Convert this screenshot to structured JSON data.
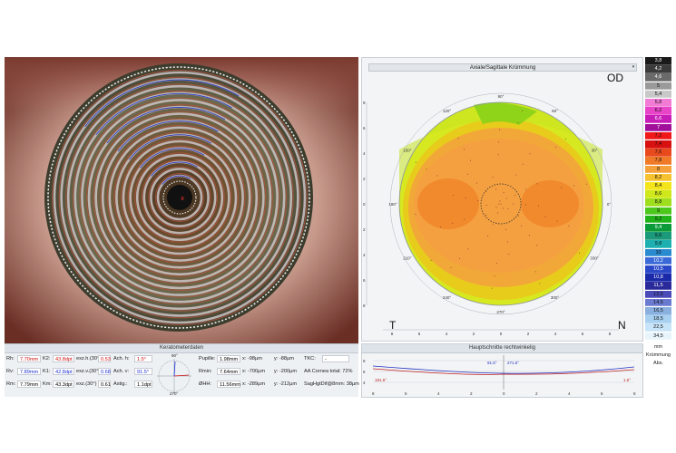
{
  "map": {
    "title": "Axiale/Sagittale Krümmung",
    "dropdown_glyph": "▾",
    "eye_side": "OD",
    "temporal_label": "T",
    "nasal_label": "N",
    "angle_labels": [
      "90°",
      "60°",
      "30°",
      "0°",
      "330°",
      "300°",
      "270°",
      "240°",
      "210°",
      "180°",
      "150°",
      "120°"
    ],
    "axis_ticks_h": [
      "8",
      "6",
      "4",
      "2",
      "0",
      "2",
      "4",
      "6",
      "8"
    ],
    "axis_ticks_v": [
      "8",
      "6",
      "4",
      "2",
      "0",
      "2",
      "4",
      "6",
      "8"
    ]
  },
  "scale": {
    "values": [
      "3,8",
      "4,2",
      "4,6",
      "5",
      "5,4",
      "5,8",
      "6,2",
      "6,6",
      "7",
      "7,2",
      "7,4",
      "7,6",
      "7,8",
      "8",
      "8,2",
      "8,4",
      "8,6",
      "8,8",
      "9",
      "9,2",
      "9,4",
      "9,6",
      "9,8",
      "10",
      "10,2",
      "10,5",
      "10,8",
      "11,5",
      "12,5",
      "14,5",
      "16,5",
      "18,5",
      "22,5",
      "34,5"
    ],
    "colors": [
      "#1a1a1a",
      "#3b3b3b",
      "#6a6a6a",
      "#9a9a9a",
      "#c8c8c8",
      "#f27bd6",
      "#e844c8",
      "#c81eb8",
      "#a0109a",
      "#f01818",
      "#d81010",
      "#e84a1e",
      "#f07a28",
      "#f5a03a",
      "#f7c230",
      "#f3e41c",
      "#cfe81c",
      "#9fde1c",
      "#4cc81c",
      "#20b41a",
      "#0a9a3a",
      "#1a9a7a",
      "#1eb0b0",
      "#2a8ad0",
      "#3a6ad8",
      "#2a48c8",
      "#1a2aa8",
      "#2a2a9a",
      "#4a4ab8",
      "#6a7ad0",
      "#8ab0e0",
      "#a8d0f0",
      "#c8e4f8",
      "#e8f4fc"
    ],
    "unit1": "mm",
    "unit2": "Krümmung",
    "unit3": "Abs."
  },
  "kerato": {
    "title": "Keratometerdaten",
    "rows": [
      {
        "r_label": "Rh:",
        "r_val": "7.70mm",
        "k_label": "K2:",
        "k_val": "43.8dpt",
        "exz_label": "exz.h.(30°)",
        "exz_val": "0.53",
        "ach_label": "Ach. h:",
        "ach_val": "1.5°"
      },
      {
        "r_label": "Rv:",
        "r_val": "7.89mm",
        "k_label": "K1:",
        "k_val": "42.8dpt",
        "exz_label": "exz.v.(30°)",
        "exz_val": "0.68",
        "ach_label": "Ach. v:",
        "ach_val": "91.5°"
      },
      {
        "r_label": "Rm:",
        "r_val": "7.79mm",
        "k_label": "Km:",
        "k_val": "43.3dpt",
        "exz_label": "exz.(30°)",
        "exz_val": "0.61",
        "ach_label": "Astig.:",
        "ach_val": "1.1dpt"
      }
    ],
    "compass_top": "90°",
    "compass_bottom": "270°",
    "right_rows": [
      {
        "label": "Pupille:",
        "val": "1.98mm",
        "x": "x: -98µm",
        "y": "y: -88µm",
        "extra_label": "TKC:",
        "extra_val": "-"
      },
      {
        "label": "Rmin:",
        "val": "7.64mm",
        "x": "x: -700µm",
        "y": "y: -200µm",
        "extra_label": "AA Cornea total: 72%",
        "extra_val": ""
      },
      {
        "label": "ØHH:",
        "val": "11.56mm",
        "x": "x: -289µm",
        "y": "y: -212µm",
        "extra_label": "SagHgtDif@8mm: 38µm",
        "extra_val": ""
      }
    ]
  },
  "profile": {
    "title": "Hauptschnitte rechtwinkelig",
    "left_values": [
      "181.5°"
    ],
    "mid_values": [
      "91.5°",
      "271.5°"
    ],
    "right_values": [
      "1.5°"
    ],
    "ticks": [
      "8",
      "6",
      "4",
      "2",
      "0",
      "2",
      "4",
      "6",
      "8"
    ],
    "y_ticks": [
      "8",
      "6",
      "4"
    ]
  }
}
